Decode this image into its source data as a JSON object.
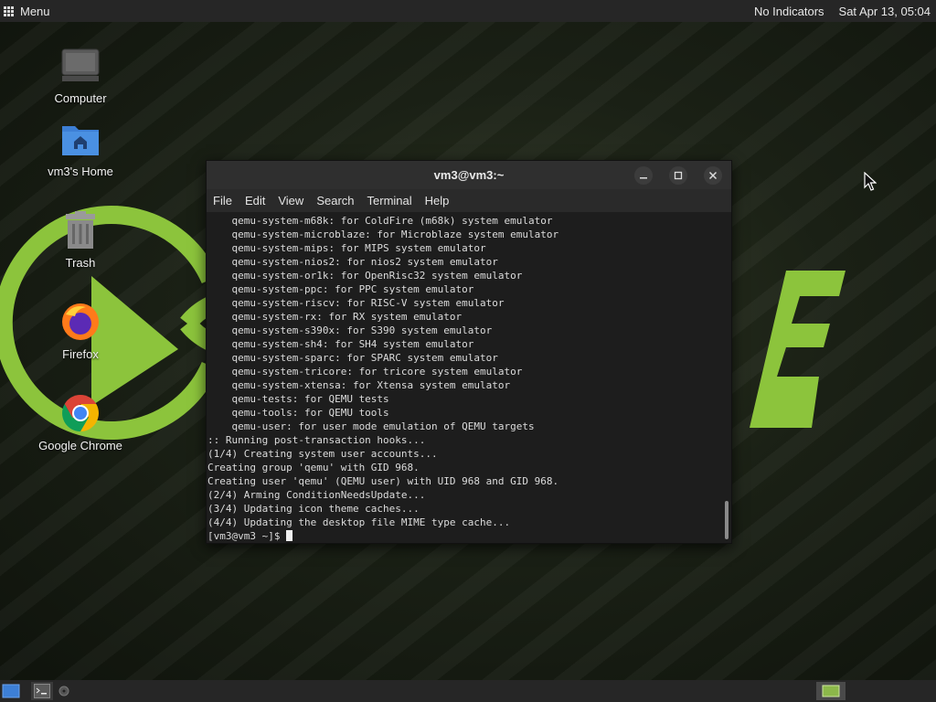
{
  "top_panel": {
    "menu_label": "Menu",
    "indicators": "No Indicators",
    "clock": "Sat Apr 13, 05:04"
  },
  "desktop": {
    "icons": [
      {
        "label": "Computer",
        "icon": "computer-icon"
      },
      {
        "label": "vm3's Home",
        "icon": "home-folder-icon"
      },
      {
        "label": "Trash",
        "icon": "trash-icon"
      },
      {
        "label": "Firefox",
        "icon": "firefox-icon"
      },
      {
        "label": "Google Chrome",
        "icon": "chrome-icon"
      }
    ]
  },
  "terminal": {
    "title": "vm3@vm3:~",
    "menu": [
      "File",
      "Edit",
      "View",
      "Search",
      "Terminal",
      "Help"
    ],
    "lines": [
      "    qemu-system-m68k: for ColdFire (m68k) system emulator",
      "    qemu-system-microblaze: for Microblaze system emulator",
      "    qemu-system-mips: for MIPS system emulator",
      "    qemu-system-nios2: for nios2 system emulator",
      "    qemu-system-or1k: for OpenRisc32 system emulator",
      "    qemu-system-ppc: for PPC system emulator",
      "    qemu-system-riscv: for RISC-V system emulator",
      "    qemu-system-rx: for RX system emulator",
      "    qemu-system-s390x: for S390 system emulator",
      "    qemu-system-sh4: for SH4 system emulator",
      "    qemu-system-sparc: for SPARC system emulator",
      "    qemu-system-tricore: for tricore system emulator",
      "    qemu-system-xtensa: for Xtensa system emulator",
      "    qemu-tests: for QEMU tests",
      "    qemu-tools: for QEMU tools",
      "    qemu-user: for user mode emulation of QEMU targets",
      ":: Running post-transaction hooks...",
      "(1/4) Creating system user accounts...",
      "Creating group 'qemu' with GID 968.",
      "Creating user 'qemu' (QEMU user) with UID 968 and GID 968.",
      "(2/4) Arming ConditionNeedsUpdate...",
      "(3/4) Updating icon theme caches...",
      "(4/4) Updating the desktop file MIME type cache..."
    ],
    "prompt": "[vm3@vm3 ~]$ "
  },
  "colors": {
    "accent_green": "#8cc43c",
    "panel": "#262626",
    "terminal_bg": "#1d1d1d"
  }
}
